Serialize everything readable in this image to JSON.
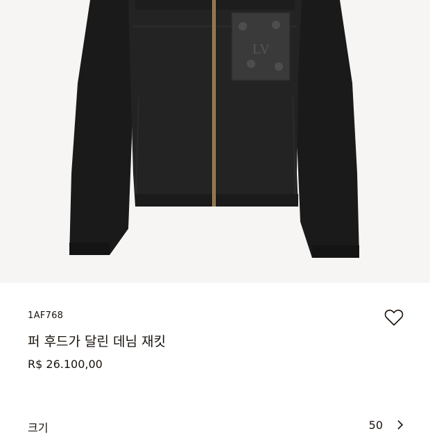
{
  "product": {
    "sku": "1AF768",
    "title": "퍼 후드가 달린 데님 재킷",
    "price": "R$ 26.100,00",
    "image_icon": "black-denim-jacket-image"
  },
  "wishlist": {
    "icon": "heart-outline-icon"
  },
  "size": {
    "label": "크기",
    "value": "50",
    "icon": "chevron-right-icon"
  },
  "colors": {
    "background": "#ffffff",
    "image_background": "#f6f5f3",
    "text": "#19110b",
    "jacket": "#1c1c1c",
    "zipper": "#a8865a"
  }
}
